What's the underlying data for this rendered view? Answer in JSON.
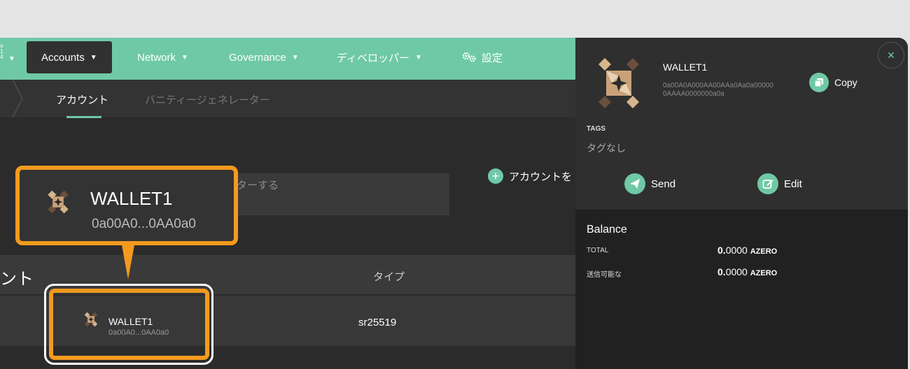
{
  "nav": {
    "chain_lines": [
      "o",
      "1",
      "4"
    ],
    "accounts": "Accounts",
    "network": "Network",
    "governance": "Governance",
    "developer": "ディベロッパー",
    "settings": "設定"
  },
  "subnav": {
    "accounts": "アカウント",
    "vanity": "バニティージェネレーター"
  },
  "toolbar": {
    "filter_text": "ターする",
    "add_account": "アカウントを"
  },
  "table": {
    "header_name": "ント",
    "header_type": "タイプ",
    "row": {
      "name": "WALLET1",
      "address": "0a00A0...0AA0a0",
      "type": "sr25519"
    }
  },
  "callout": {
    "name": "WALLET1",
    "address": "0a00A0...0AA0a0"
  },
  "sidebar": {
    "name": "WALLET1",
    "address_full": "0a00A0A000AA00AAa0Aa0a000000AAAA0000000a0a",
    "copy": "Copy",
    "tags_label": "TAGS",
    "tags_value": "タグなし",
    "send": "Send",
    "edit": "Edit",
    "balance_title": "Balance",
    "total_label": "TOTAL",
    "total_int": "0.",
    "total_dec": "0000",
    "total_unit": "AZERO",
    "transferable_label": "送信可能な",
    "transferable_int": "0.",
    "transferable_dec": "0000",
    "transferable_unit": "AZERO"
  },
  "colors": {
    "accent": "#6fc9a6",
    "highlight": "#f39a1e"
  }
}
